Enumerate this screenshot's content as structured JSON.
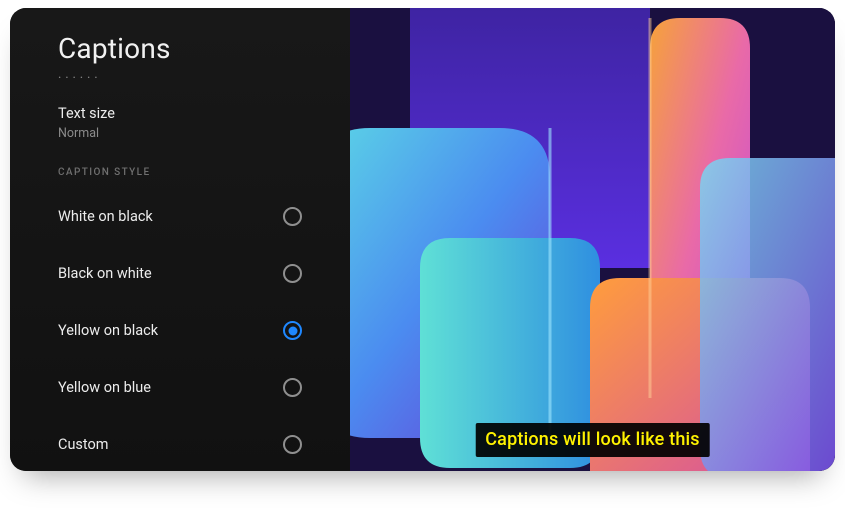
{
  "page": {
    "title": "Captions"
  },
  "truncated_prev": ". . . . . .",
  "text_size": {
    "label": "Text size",
    "value": "Normal"
  },
  "section_header": "CAPTION STYLE",
  "options": [
    {
      "label": "White on black",
      "selected": false
    },
    {
      "label": "Black on white",
      "selected": false
    },
    {
      "label": "Yellow on black",
      "selected": true
    },
    {
      "label": "Yellow on blue",
      "selected": false
    },
    {
      "label": "Custom",
      "selected": false
    }
  ],
  "preview": {
    "sample_text": "Captions will look like this",
    "caption_fg": "#fff200",
    "caption_bg": "rgba(0,0,0,0.92)"
  }
}
